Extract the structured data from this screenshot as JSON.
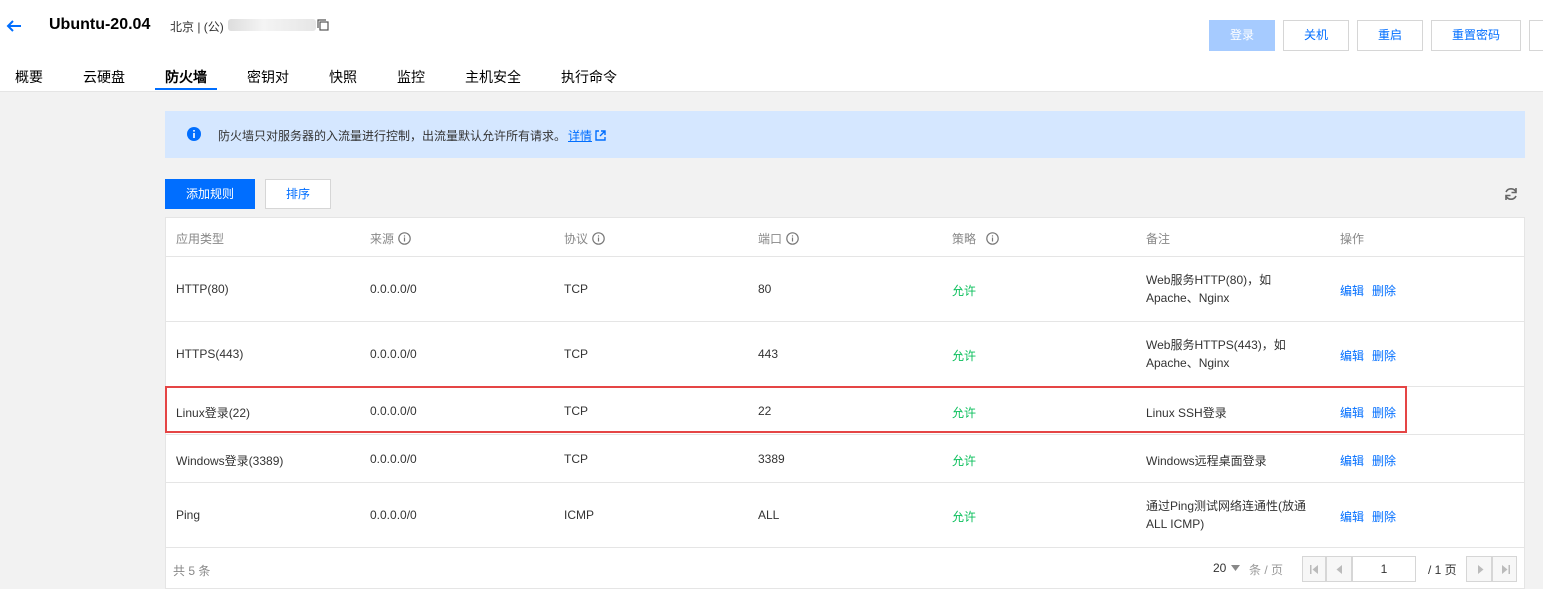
{
  "header": {
    "title": "Ubuntu-20.04",
    "region": "北京 | (公)",
    "buttons": {
      "login": "登录",
      "shutdown": "关机",
      "restart": "重启",
      "reset_password": "重置密码"
    }
  },
  "tabs": [
    "概要",
    "云硬盘",
    "防火墙",
    "密钥对",
    "快照",
    "监控",
    "主机安全",
    "执行命令"
  ],
  "active_tab": "防火墙",
  "notice": {
    "text": "防火墙只对服务器的入流量进行控制，出流量默认允许所有请求。",
    "link": "详情"
  },
  "toolbar": {
    "add_rule": "添加规则",
    "sort": "排序"
  },
  "table": {
    "headers": [
      "应用类型",
      "来源",
      "协议",
      "端口",
      "策略",
      "备注",
      "操作"
    ],
    "rows": [
      {
        "app": "HTTP(80)",
        "source": "0.0.0.0/0",
        "protocol": "TCP",
        "port": "80",
        "policy": "允许",
        "note": "Web服务HTTP(80)，如Apache、Nginx",
        "edit": "编辑",
        "delete": "删除"
      },
      {
        "app": "HTTPS(443)",
        "source": "0.0.0.0/0",
        "protocol": "TCP",
        "port": "443",
        "policy": "允许",
        "note": "Web服务HTTPS(443)，如Apache、Nginx",
        "edit": "编辑",
        "delete": "删除"
      },
      {
        "app": "Linux登录(22)",
        "source": "0.0.0.0/0",
        "protocol": "TCP",
        "port": "22",
        "policy": "允许",
        "note": "Linux SSH登录",
        "edit": "编辑",
        "delete": "删除"
      },
      {
        "app": "Windows登录(3389)",
        "source": "0.0.0.0/0",
        "protocol": "TCP",
        "port": "3389",
        "policy": "允许",
        "note": "Windows远程桌面登录",
        "edit": "编辑",
        "delete": "删除"
      },
      {
        "app": "Ping",
        "source": "0.0.0.0/0",
        "protocol": "ICMP",
        "port": "ALL",
        "policy": "允许",
        "note": "通过Ping测试网络连通性(放通ALL ICMP)",
        "edit": "编辑",
        "delete": "删除"
      }
    ]
  },
  "pagination": {
    "total": "共 5 条",
    "page_size": "20",
    "page_size_unit": "条 / 页",
    "current_page": "1",
    "total_pages": "/ 1 页"
  },
  "colors": {
    "accent": "#006eff",
    "allow": "#0abf5b",
    "highlight": "#e54545",
    "notice_bg": "#d5e7ff"
  }
}
